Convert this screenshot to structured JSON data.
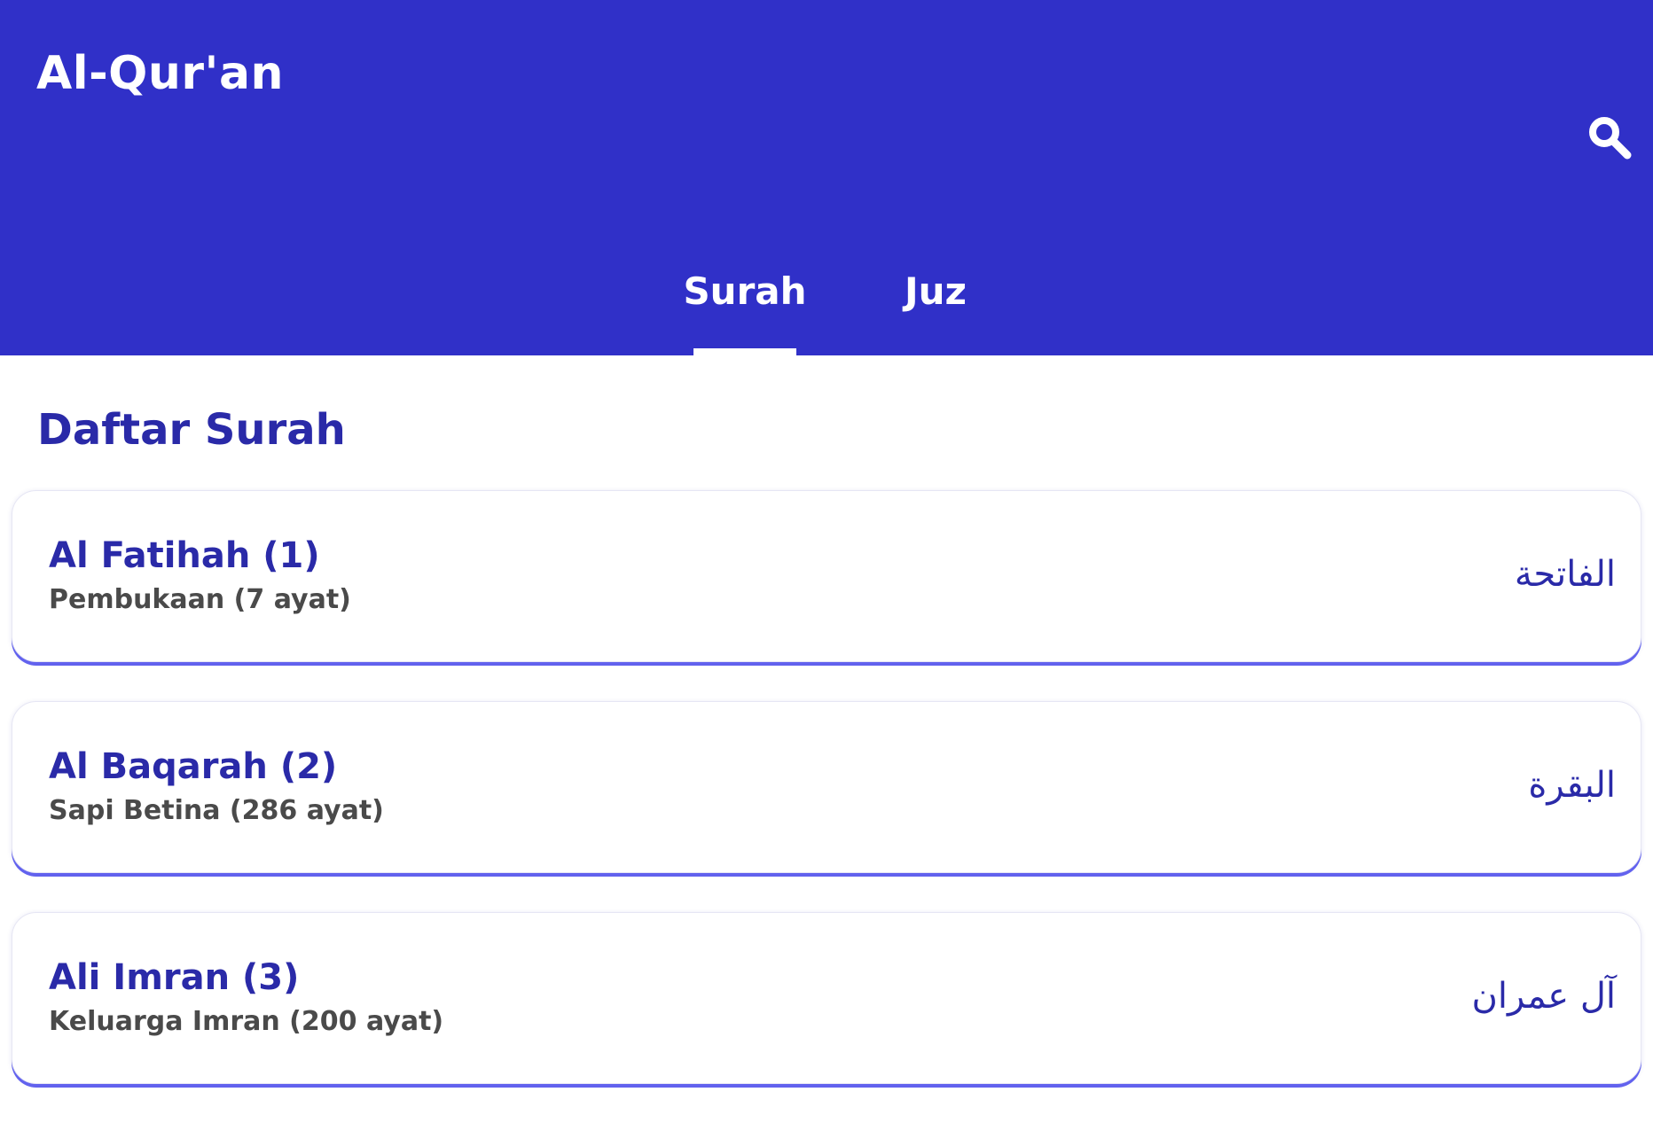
{
  "header": {
    "title": "Al-Qur'an",
    "search_icon": "search-icon",
    "background_color": "#3030c8"
  },
  "tabs": [
    {
      "label": "Surah",
      "active": true
    },
    {
      "label": "Juz",
      "active": false
    }
  ],
  "section": {
    "title": "Daftar Surah"
  },
  "surahs": [
    {
      "name": "Al Fatihah (1)",
      "meaning": "Pembukaan (7 ayat)",
      "arabic": "الفاتحة"
    },
    {
      "name": "Al Baqarah (2)",
      "meaning": "Sapi Betina (286 ayat)",
      "arabic": "البقرة"
    },
    {
      "name": "Ali Imran (3)",
      "meaning": "Keluarga Imran (200 ayat)",
      "arabic": "آل عمران"
    }
  ],
  "colors": {
    "accent": "#3030c8",
    "title_text": "#2a2aa8",
    "subtitle_text": "#4a4a4a",
    "card_shadow": "#6262ee"
  }
}
